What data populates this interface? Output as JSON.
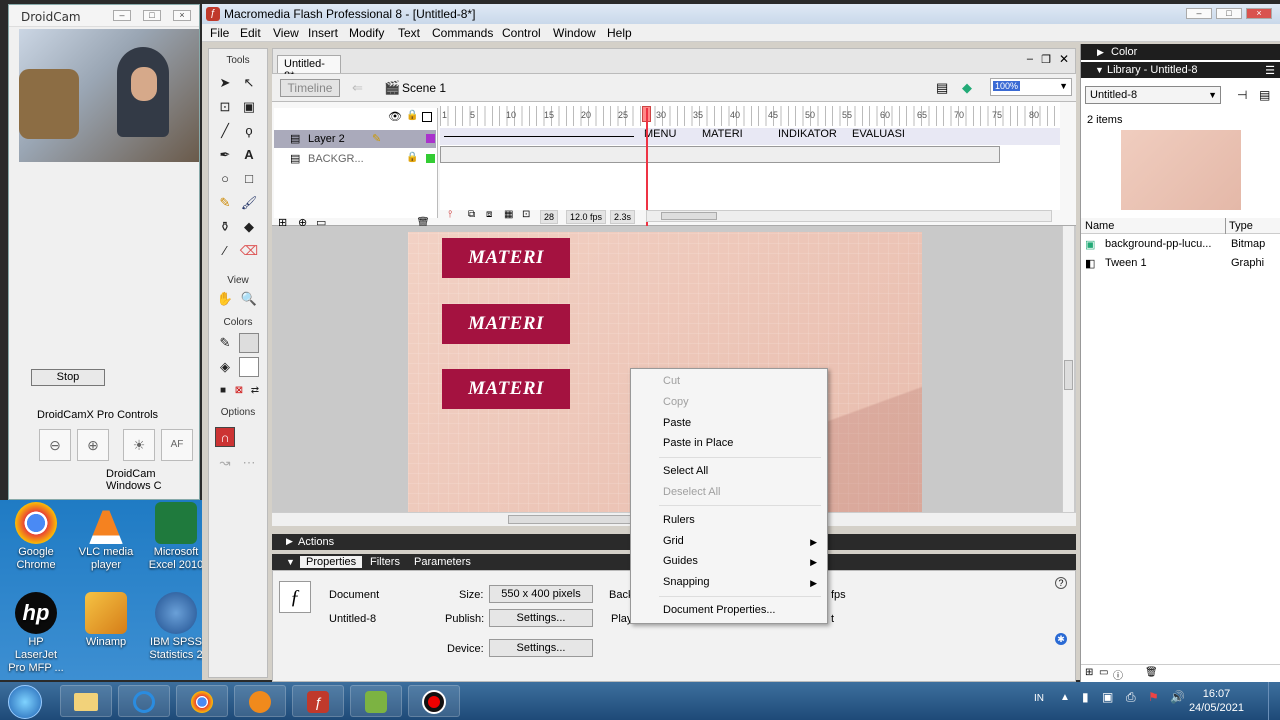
{
  "droidcam": {
    "title": "DroidCam",
    "stop_label": "Stop",
    "pro_controls_label": "DroidCamX Pro Controls",
    "af_label": "AF",
    "windows_label": "DroidCam Windows C"
  },
  "desktop_icons": [
    {
      "label": "Google Chrome",
      "icon": "chrome-icon"
    },
    {
      "label": "VLC media player",
      "icon": "vlc-icon"
    },
    {
      "label": "Microsoft Excel 2010",
      "icon": "excel-icon"
    },
    {
      "label": "HP LaserJet Pro MFP ...",
      "icon": "hp-icon"
    },
    {
      "label": "Winamp",
      "icon": "winamp-icon"
    },
    {
      "label": "IBM SPSS Statistics 2",
      "icon": "spss-icon"
    }
  ],
  "flash": {
    "title": "Macromedia Flash Professional 8 - [Untitled-8*]",
    "menu": [
      "File",
      "Edit",
      "View",
      "Insert",
      "Modify",
      "Text",
      "Commands",
      "Control",
      "Window",
      "Help"
    ],
    "tools_label": "Tools",
    "view_label": "View",
    "colors_label": "Colors",
    "options_label": "Options",
    "doc_tab": "Untitled-8*",
    "timeline_button": "Timeline",
    "scene": "Scene 1",
    "zoom": "100%",
    "layers": [
      {
        "name": "Layer 2"
      },
      {
        "name": "BACKGR..."
      }
    ],
    "frame_numbers": [
      "1",
      "5",
      "10",
      "15",
      "20",
      "25",
      "30",
      "35",
      "40",
      "45",
      "50",
      "55",
      "60",
      "65",
      "70",
      "75",
      "80"
    ],
    "frame_labels": [
      "MENU",
      "MATERI",
      "INDIKATOR",
      "EVALUASI"
    ],
    "current_frame": "28",
    "fps": "12.0 fps",
    "time": "2.3s",
    "stage_buttons": [
      "MATERI",
      "MATERI",
      "MATERI"
    ],
    "actions_label": "Actions",
    "prop_tabs": [
      "Properties",
      "Filters",
      "Parameters"
    ],
    "props": {
      "doc_label": "Document",
      "doc_name": "Untitled-8",
      "size_label": "Size:",
      "size_value": "550 x 400 pixels",
      "publish_label": "Publish:",
      "settings_label": "Settings...",
      "device_label": "Device:",
      "back_label": "Backg",
      "player_label": "Playe",
      "fps_suffix": "fps",
      "t_suffix": "t"
    }
  },
  "library": {
    "color_label": "Color",
    "title": "Library - Untitled-8",
    "select": "Untitled-8",
    "count": "2 items",
    "col_name": "Name",
    "col_type": "Type",
    "items": [
      {
        "name": "background-pp-lucu...",
        "type": "Bitmap"
      },
      {
        "name": "Tween 1",
        "type": "Graphi"
      }
    ]
  },
  "context_menu": [
    {
      "label": "Cut",
      "disabled": true
    },
    {
      "label": "Copy",
      "disabled": true
    },
    {
      "label": "Paste",
      "disabled": false
    },
    {
      "label": "Paste in Place",
      "disabled": false
    },
    {
      "label": "Select All",
      "disabled": false
    },
    {
      "label": "Deselect All",
      "disabled": true
    },
    {
      "label": "Rulers",
      "disabled": false
    },
    {
      "label": "Grid",
      "disabled": false
    },
    {
      "label": "Guides",
      "disabled": false
    },
    {
      "label": "Snapping",
      "disabled": false
    },
    {
      "label": "Document Properties...",
      "disabled": false
    }
  ],
  "taskbar": {
    "lang": "IN",
    "time": "16:07",
    "date": "24/05/2021"
  },
  "colors": {
    "materi_button": "#a41240",
    "stage_bg": "#f0cdbf",
    "panel_dark": "#1e1e1e"
  }
}
